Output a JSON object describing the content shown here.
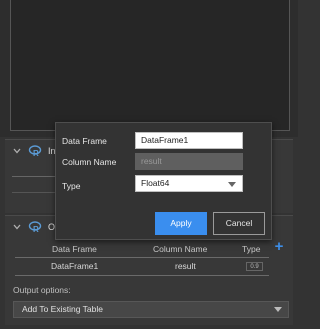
{
  "input_section": {
    "title_visible": "Inp"
  },
  "output_section": {
    "title_visible": "Ou",
    "columns": [
      "Data Frame",
      "Column Name",
      "Type"
    ],
    "rows": [
      {
        "data_frame": "DataFrame1",
        "column_name": "result",
        "type": "0.9"
      }
    ],
    "output_options_label": "Output options:",
    "output_option_selected": "Add To Existing Table"
  },
  "dialog": {
    "data_frame_label": "Data Frame",
    "data_frame_value": "DataFrame1",
    "column_name_label": "Column Name",
    "column_name_value": "result",
    "type_label": "Type",
    "type_value": "Float64",
    "apply_label": "Apply",
    "cancel_label": "Cancel"
  },
  "colors": {
    "accent": "#3a8eef",
    "background": "#333333",
    "section": "#383838"
  }
}
